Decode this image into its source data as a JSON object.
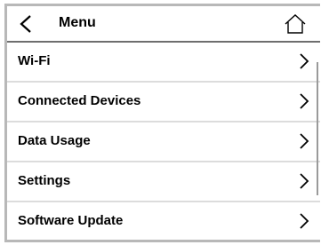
{
  "header": {
    "title": "Menu"
  },
  "menu": {
    "items": [
      {
        "label": "Wi-Fi"
      },
      {
        "label": "Connected Devices"
      },
      {
        "label": "Data Usage"
      },
      {
        "label": "Settings"
      },
      {
        "label": "Software Update"
      }
    ]
  },
  "icons": {
    "back": "chevron-left-icon",
    "home": "home-icon",
    "item_arrow": "chevron-right-icon"
  },
  "scroll": {
    "position_fraction": 0.1
  }
}
